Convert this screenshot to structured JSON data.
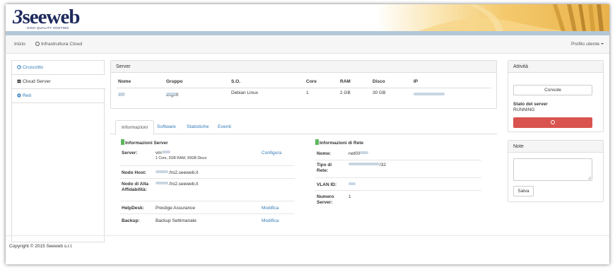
{
  "brand": {
    "logo_mark": "3",
    "logo_text": "seeweb",
    "tagline": "HIGH QUALITY HOSTING"
  },
  "topnav": {
    "home": "Inizio",
    "infra": "Infrastruttura Cloud",
    "profile": "Profilo utente"
  },
  "sidebar": {
    "items": [
      {
        "label": "Cruscotto",
        "icon": "dashboard-icon"
      },
      {
        "label": "Cloud Server",
        "icon": "server-icon"
      },
      {
        "label": "Reti",
        "icon": "network-icon"
      }
    ]
  },
  "server_panel": {
    "title": "Server",
    "columns": [
      "Nome",
      "Gruppo",
      "S.O.",
      "Core",
      "RAM",
      "Disco",
      "IP"
    ],
    "row": {
      "nome": "vm",
      "gruppo": "csg00",
      "so": "Debian Linux",
      "core": "1",
      "ram": "2 GB",
      "disco": "30 GB",
      "ip": ""
    }
  },
  "tabs": [
    "Informazioni",
    "Software",
    "Statistiche",
    "Eventi"
  ],
  "info_server": {
    "title": "Informazioni Server",
    "server_label": "Server:",
    "server_value": "vm",
    "server_spec": "1 Core, 2GB RAM, 30GB Disco",
    "server_link": "Configura",
    "host_label": "Nodo Host:",
    "host_value": ".fro2.seeweb.it",
    "ha_label": "Nodo di Alta Affidabilità:",
    "ha_value": ".fro2.seeweb.it",
    "helpdesk_label": "HelpDesk:",
    "helpdesk_value": "Prestige Assurance",
    "helpdesk_link": "Modifica",
    "backup_label": "Backup:",
    "backup_value": "Backup Settimanale",
    "backup_link": "Modifica"
  },
  "info_rete": {
    "title": "Informazioni di Rete",
    "nome_label": "Nome:",
    "nome_value": "net00",
    "tipo_label": "Tipo di Rete:",
    "tipo_value": "/32",
    "vlan_label": "VLAN ID:",
    "vlan_value": "",
    "num_label": "Numero Server:",
    "num_value": "1"
  },
  "attivita": {
    "title": "Attività",
    "console_label": "Console",
    "state_label": "Stato del server",
    "state_value": "RUNNING"
  },
  "note": {
    "title": "Note",
    "save_label": "Salva"
  },
  "footer": "Copyright © 2015 Seeweb s.r.l.",
  "colors": {
    "link": "#337ab7",
    "danger": "#d9534f",
    "success": "#5cb85c",
    "stripe": "#b3c7d6"
  }
}
